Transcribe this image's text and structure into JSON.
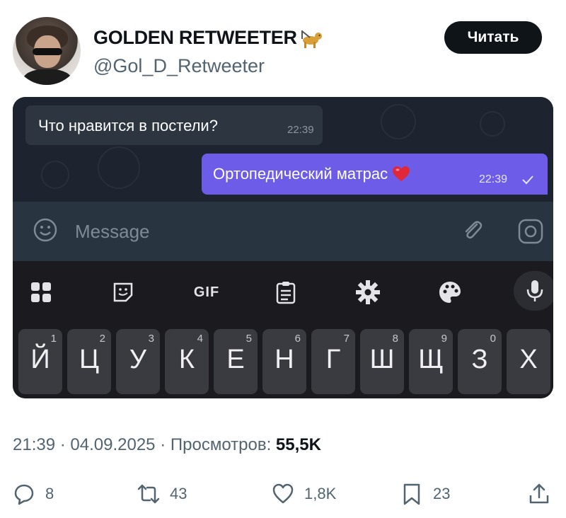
{
  "author": {
    "display_name": "GOLDEN RETWEETER",
    "handle": "@Gol_D_Retweeter",
    "badge_icon": "guide-dog-icon"
  },
  "follow_button": {
    "label": "Читать"
  },
  "chat": {
    "incoming": {
      "text": "Что нравится в постели?",
      "time": "22:39"
    },
    "outgoing": {
      "text": "Ортопедический матрас",
      "emoji": "heart-icon",
      "time": "22:39",
      "status": "sent-check-icon"
    },
    "input_placeholder": "Message"
  },
  "keyboard": {
    "toolbar": [
      {
        "name": "apps-grid-icon"
      },
      {
        "name": "sticker-icon"
      },
      {
        "name": "gif-button",
        "label": "GIF"
      },
      {
        "name": "clipboard-icon"
      },
      {
        "name": "settings-gear-icon"
      },
      {
        "name": "palette-icon"
      },
      {
        "name": "microphone-icon"
      }
    ],
    "keys": [
      {
        "char": "Й",
        "num": "1"
      },
      {
        "char": "Ц",
        "num": "2"
      },
      {
        "char": "У",
        "num": "3"
      },
      {
        "char": "К",
        "num": "4"
      },
      {
        "char": "Е",
        "num": "5"
      },
      {
        "char": "Н",
        "num": "6"
      },
      {
        "char": "Г",
        "num": "7"
      },
      {
        "char": "Ш",
        "num": "8"
      },
      {
        "char": "Щ",
        "num": "9"
      },
      {
        "char": "З",
        "num": "0"
      },
      {
        "char": "Х",
        "num": ""
      }
    ]
  },
  "meta": {
    "time": "21:39",
    "date": "04.09.2025",
    "views_label": "Просмотров:",
    "views_count": "55,5K"
  },
  "actions": {
    "replies": "8",
    "retweets": "43",
    "likes": "1,8K",
    "bookmarks": "23"
  },
  "colors": {
    "accent_outgoing": "#6c5ce7",
    "text_primary": "#0f1419",
    "text_secondary": "#536471"
  }
}
